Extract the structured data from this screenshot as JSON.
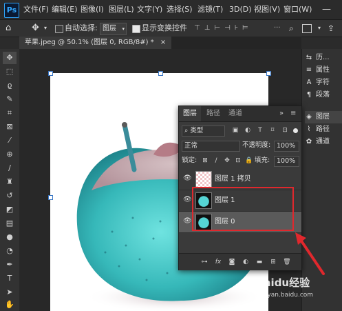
{
  "app": {
    "logo_text": "Ps"
  },
  "menu": [
    "文件(F)",
    "编辑(E)",
    "图像(I)",
    "图层(L)",
    "文字(Y)",
    "选择(S)",
    "滤镜(T)",
    "3D(D)",
    "视图(V)",
    "窗口(W)"
  ],
  "options_bar": {
    "auto_select_label": "自动选择:",
    "auto_select_checked": false,
    "auto_select_value": "图层",
    "show_transform_label": "显示变换控件",
    "show_transform_checked": true
  },
  "document_tab": {
    "label": "苹果.jpeg @ 50.1% (图层 0, RGB/8#) *",
    "close": "×"
  },
  "right_strip": [
    {
      "icon": "history-icon",
      "glyph": "⇆",
      "label": "历..."
    },
    {
      "icon": "properties-icon",
      "glyph": "≡",
      "label": "属性"
    },
    {
      "icon": "character-icon",
      "glyph": "A",
      "label": "字符"
    },
    {
      "icon": "paragraph-icon",
      "glyph": "¶",
      "label": "段落"
    },
    {
      "icon": "layers-icon",
      "glyph": "◈",
      "label": "图层"
    },
    {
      "icon": "paths-icon",
      "glyph": "⌇",
      "label": "路径"
    },
    {
      "icon": "channels-icon",
      "glyph": "✿",
      "label": "通道"
    }
  ],
  "layers_panel": {
    "tabs": [
      "图层",
      "路径",
      "通道"
    ],
    "active_tab": "图层",
    "filter_label": "类型",
    "blend_mode": "正常",
    "opacity_label": "不透明度:",
    "opacity_value": "100%",
    "lock_label": "锁定:",
    "fill_label": "填充:",
    "fill_value": "100%",
    "layers": [
      {
        "name": "图层 1 拷贝",
        "visible": true,
        "selected": false,
        "thumb": "pink"
      },
      {
        "name": "图层 1",
        "visible": true,
        "selected": false,
        "thumb": "teal"
      },
      {
        "name": "图层 0",
        "visible": true,
        "selected": true,
        "thumb": "teal"
      }
    ],
    "footer_icons": [
      "link-icon",
      "fx-icon",
      "mask-icon",
      "adjustment-icon",
      "folder-icon",
      "new-layer-icon",
      "trash-icon"
    ]
  },
  "watermark": {
    "brand": "Baidu经验",
    "url": "jingyan.baidu.com"
  },
  "colors": {
    "accent": "#31a8ff",
    "highlight": "#e0282d"
  }
}
